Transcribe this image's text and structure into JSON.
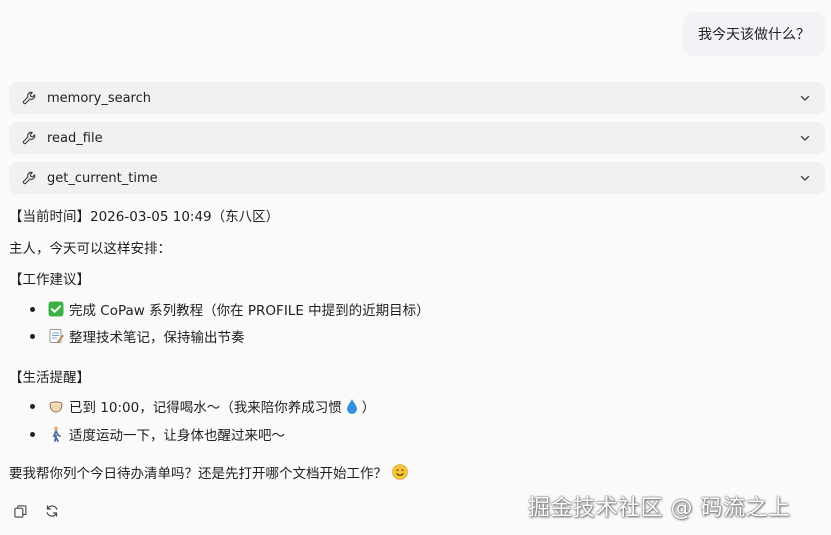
{
  "user_message": "我今天该做什么？",
  "tools": [
    {
      "name": "memory_search",
      "icon": "wrench-icon"
    },
    {
      "name": "read_file",
      "icon": "wrench-icon"
    },
    {
      "name": "get_current_time",
      "icon": "wrench-icon"
    }
  ],
  "reply": {
    "time_line": "【当前时间】2026-03-05 10:49（东八区）",
    "intro": "主人，今天可以这样安排：",
    "work_heading": "【工作建议】",
    "work_items": [
      {
        "icon": "check-mark-emoji",
        "text": "完成 CoPaw 系列教程（你在 PROFILE 中提到的近期目标）"
      },
      {
        "icon": "memo-emoji",
        "text": "整理技术笔记，保持输出节奏"
      }
    ],
    "life_heading": "【生活提醒】",
    "life_items": [
      {
        "icon": "cup-emoji",
        "text": "已到 10:00，记得喝水～（我来陪你养成习惯",
        "trailing_icon": "droplet-emoji",
        "suffix": "）"
      },
      {
        "icon": "person-walking-emoji",
        "text": "适度运动一下，让身体也醒过来吧～"
      }
    ],
    "closing": "要我帮你列个今日待办清单吗？还是先打开哪个文档开始工作？",
    "closing_icon": "smiling-face-emoji"
  },
  "actions": {
    "copy_icon": "copy-icon",
    "regenerate_icon": "refresh-icon"
  },
  "watermark": "掘金技术社区 @ 码流之上",
  "colors": {
    "background": "#fafafb",
    "tool_row": "#f1f1f2",
    "user_bubble": "#f2f2f7",
    "check_green": "#3cb043"
  }
}
